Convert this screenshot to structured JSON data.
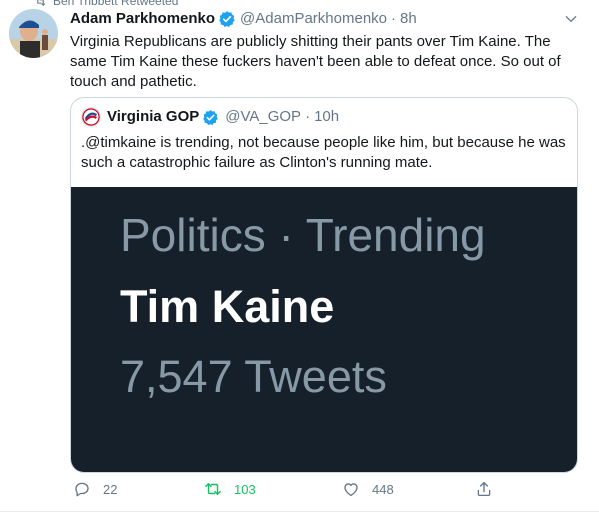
{
  "retweet_context": {
    "text": "Ben Tribbett Retweeted"
  },
  "tweet": {
    "name": "Adam Parkhomenko",
    "handle": "@AdamParkhomenko",
    "separator": "·",
    "time": "8h",
    "text": "Virginia Republicans are publicly shitting their pants over Tim Kaine. The same Tim Kaine these fuckers haven't been able to defeat once. So out of touch and pathetic."
  },
  "quoted_tweet": {
    "name": "Virginia GOP",
    "handle": "@VA_GOP",
    "separator": "·",
    "time": "10h",
    "text": ".@timkaine is trending, not because people like him, but because he was such a catastrophic failure as Clinton's running mate.",
    "media": {
      "line1": "Politics · Trending",
      "line2": "Tim Kaine",
      "line3": "7,547 Tweets"
    }
  },
  "actions": {
    "replies": "22",
    "retweets": "103",
    "likes": "448"
  },
  "colors": {
    "verified_blue": "#1da1f2",
    "retweet_green": "#17bf63",
    "media_bg": "#15202b"
  },
  "icons": [
    "retweet-icon",
    "verified-badge-icon",
    "chevron-down-icon",
    "reply-icon",
    "like-icon",
    "share-icon"
  ]
}
